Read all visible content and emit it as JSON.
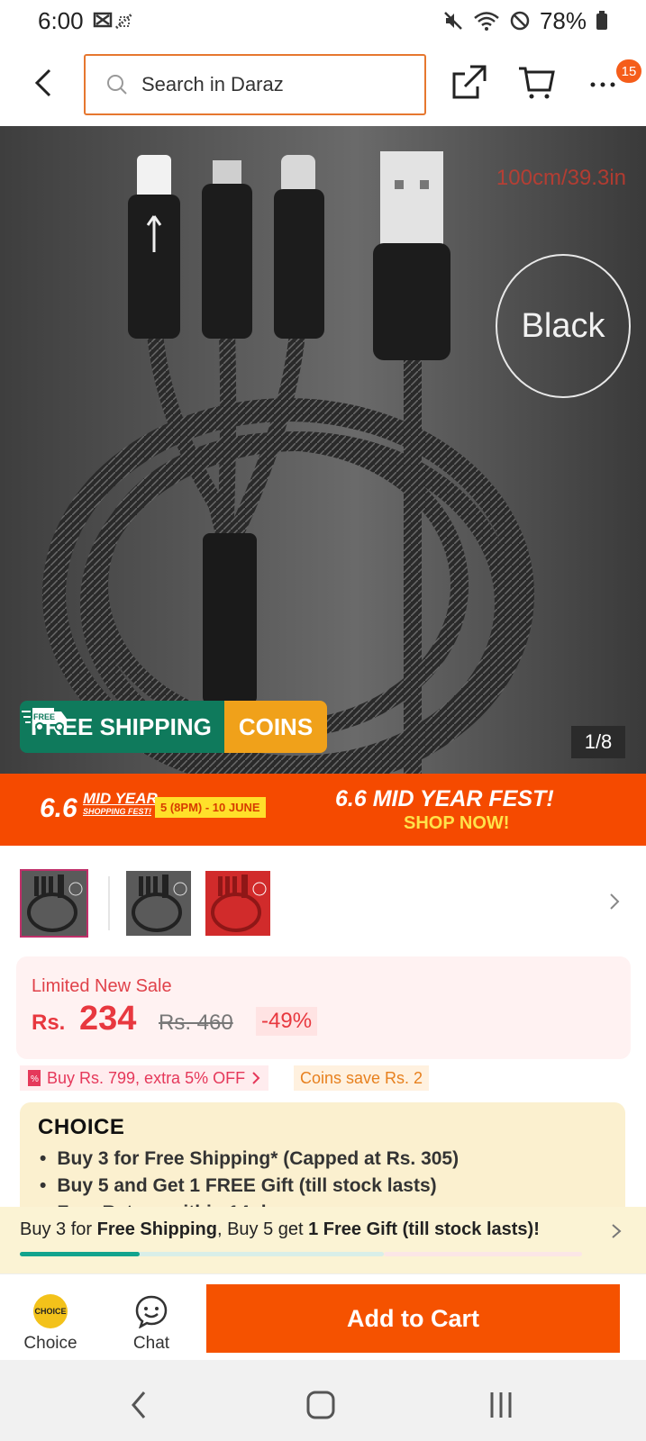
{
  "status_bar": {
    "time": "6:00",
    "battery": "78%"
  },
  "header": {
    "search_placeholder": "Search in Daraz",
    "cart_badge": "15"
  },
  "product_image": {
    "length_label": "100cm/39.3in",
    "color_label": "Black",
    "shipping_label": "FREE SHIPPING",
    "free_tag": "FREE",
    "coins_label": "COINS",
    "image_counter": "1/8"
  },
  "promo_banner": {
    "logo_number": "6.6",
    "logo_title": "MID YEAR",
    "logo_sub": "SHOPPING FEST!",
    "date_range": "5 (8PM) - 10 JUNE",
    "headline": "6.6 MID YEAR FEST!",
    "cta": "SHOP NOW!"
  },
  "thumbnails": [
    {
      "name": "thumb-black-cable",
      "selected": true
    },
    {
      "name": "thumb-black-cable-alt",
      "selected": false
    },
    {
      "name": "thumb-red-cable",
      "selected": false
    }
  ],
  "price": {
    "sale_label": "Limited New Sale",
    "currency": "Rs.",
    "current": "234",
    "original": "Rs. 460",
    "discount": "-49%"
  },
  "vouchers": {
    "buy_offer": "Buy Rs. 799, extra 5% OFF",
    "coins_save": "Coins save Rs. 2"
  },
  "choice": {
    "logo": "CHOICE",
    "benefits": [
      "Buy 3 for  Free Shipping* (Capped at Rs. 305)",
      "Buy 5 and Get 1 FREE Gift (till stock lasts)",
      "Free Return within 14 days"
    ]
  },
  "shipping_strip": {
    "prefix": "Buy 3 for ",
    "bold1": "Free Shipping",
    "middle": ", Buy 5 get ",
    "bold2": "1 Free Gift (till stock lasts)!",
    "progress": 0.33
  },
  "action_bar": {
    "choice_label": "Choice",
    "choice_coin_text": "CHOICE",
    "chat_label": "Chat",
    "add_to_cart": "Add to Cart"
  },
  "colors": {
    "accent": "#f55200",
    "search_border": "#e6772f",
    "price_red": "#e8383f",
    "shipping_green": "#0f7a5c",
    "coins_orange": "#f0a11a"
  }
}
